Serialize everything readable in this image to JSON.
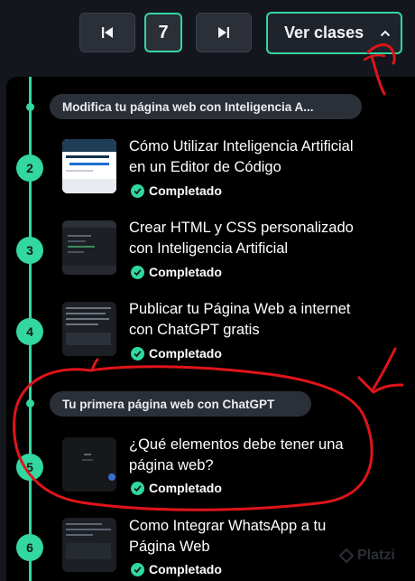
{
  "toolbar": {
    "current_page": "7",
    "classes_label": "Ver clases"
  },
  "sections": [
    {
      "title": "Modifica tu página web con Inteligencia A..."
    },
    {
      "title": "Tu primera página web con ChatGPT"
    }
  ],
  "classes": [
    {
      "number": "2",
      "title_line1": "Cómo Utilizar Inteligencia Artificial",
      "title_line2": "en un Editor de Código",
      "status": "Completado"
    },
    {
      "number": "3",
      "title_line1": "Crear HTML y CSS personalizado",
      "title_line2": "con Inteligencia Artificial",
      "status": "Completado"
    },
    {
      "number": "4",
      "title_line1": "Publicar tu Página Web a internet",
      "title_line2": "con ChatGPT gratis",
      "status": "Completado"
    },
    {
      "number": "5",
      "title_line1": "¿Qué elementos debe tener una",
      "title_line2": "página web?",
      "status": "Completado"
    },
    {
      "number": "6",
      "title_line1": "Como Integrar WhatsApp a tu",
      "title_line2": "Página Web",
      "status": "Completado"
    }
  ],
  "watermark": "Platzi",
  "colors": {
    "accent": "#33d7a0",
    "annotation": "#e0141a",
    "background": "#000000"
  }
}
